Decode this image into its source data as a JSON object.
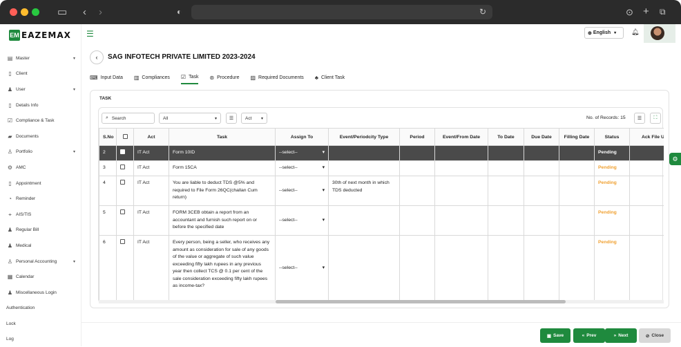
{
  "browser": {
    "address": ""
  },
  "app": {
    "logo_mark": "EM",
    "logo_text": "EAZEMAX"
  },
  "sidebar": {
    "items": [
      {
        "label": "Master",
        "icon": "file-icon",
        "chevron": true
      },
      {
        "label": "Client",
        "icon": "doc-icon",
        "chevron": false
      },
      {
        "label": "User",
        "icon": "user-icon",
        "chevron": true
      },
      {
        "label": "Details Info",
        "icon": "doc-icon",
        "chevron": false
      },
      {
        "label": "Compliance & Task",
        "icon": "task-icon",
        "chevron": false
      },
      {
        "label": "Documents",
        "icon": "folder-icon",
        "chevron": false
      },
      {
        "label": "Portfolio",
        "icon": "person-icon",
        "chevron": true
      },
      {
        "label": "AMC",
        "icon": "gear-icon",
        "chevron": false
      },
      {
        "label": "Appointment",
        "icon": "doc-icon",
        "chevron": false
      },
      {
        "label": "Reminder",
        "icon": "bell-icon",
        "chevron": false
      },
      {
        "label": "AIS/TIS",
        "icon": "tag-icon",
        "chevron": false
      },
      {
        "label": "Regular Bill",
        "icon": "user-icon",
        "chevron": false
      },
      {
        "label": "Medical",
        "icon": "user-icon",
        "chevron": false
      },
      {
        "label": "Personal Accounting",
        "icon": "person-icon",
        "chevron": true
      },
      {
        "label": "Calendar",
        "icon": "calendar-icon",
        "chevron": false
      },
      {
        "label": "Miscellaneous Login",
        "icon": "user-icon",
        "chevron": false
      },
      {
        "label": "Authentication",
        "icon": "",
        "chevron": false
      },
      {
        "label": "Lock",
        "icon": "",
        "chevron": false
      },
      {
        "label": "Log",
        "icon": "",
        "chevron": false
      }
    ]
  },
  "topbar": {
    "language": "English"
  },
  "page": {
    "title": "SAG INFOTECH PRIVATE LIMITED 2023-2024",
    "tabs": [
      {
        "label": "Input Data",
        "icon": "input-icon",
        "active": false
      },
      {
        "label": "Compliances",
        "icon": "compliance-icon",
        "active": false
      },
      {
        "label": "Task",
        "icon": "task-icon",
        "active": true
      },
      {
        "label": "Procedure",
        "icon": "procedure-icon",
        "active": false
      },
      {
        "label": "Required Documents",
        "icon": "documents-icon",
        "active": false
      },
      {
        "label": "Client Task",
        "icon": "client-task-icon",
        "active": false
      }
    ],
    "section_label": "TASK"
  },
  "filters": {
    "search_placeholder": "Search",
    "status_select": "All",
    "act_select": "Act",
    "records_label": "No. of Records: 15"
  },
  "table": {
    "headers": [
      "S.No",
      "",
      "Act",
      "Task",
      "Assign To",
      "Event/Periodcity Type",
      "Period",
      "Event/From Date",
      "To Date",
      "Due Date",
      "Filling Date",
      "Status",
      "Ack File Up"
    ],
    "rows": [
      {
        "sno": "2",
        "act": "IT Act",
        "task": "Form 10ID",
        "assign": "--select--",
        "event": "",
        "status": "Pending",
        "selected": true
      },
      {
        "sno": "3",
        "act": "IT Act",
        "task": "Form 15CA",
        "assign": "--select--",
        "event": "",
        "status": "Pending",
        "selected": false
      },
      {
        "sno": "4",
        "act": "IT Act",
        "task": "You are liable to deduct TDS @5% and required to File Form 26QC(challan Cum return)",
        "assign": "--select--",
        "event": "30th of next month in which TDS deducted",
        "status": "Pending",
        "selected": false
      },
      {
        "sno": "5",
        "act": "IT Act",
        "task": "FORM 3CEB obtain a report from an accountant and furnish such report on or before the specified date",
        "assign": "--select--",
        "event": "",
        "status": "Pending",
        "selected": false
      },
      {
        "sno": "6",
        "act": "IT Act",
        "task": "Every person, being a seller, who receives any amount as consideration for sale of any goods of the value or aggregate of such value exceeding fifty lakh rupees in any previous year then collect TCS @ 0.1 per cent of the sale consideration exceeding fifty lakh rupees as income-tax?",
        "assign": "--select--",
        "event": "",
        "status": "Pending",
        "selected": false
      }
    ]
  },
  "footer": {
    "save": "Save",
    "prev": "Prev",
    "next": "Next",
    "close": "Close"
  },
  "colors": {
    "brand_green": "#1f8a3e",
    "pending": "#f0a030",
    "selected_row": "#4a4a4a"
  }
}
